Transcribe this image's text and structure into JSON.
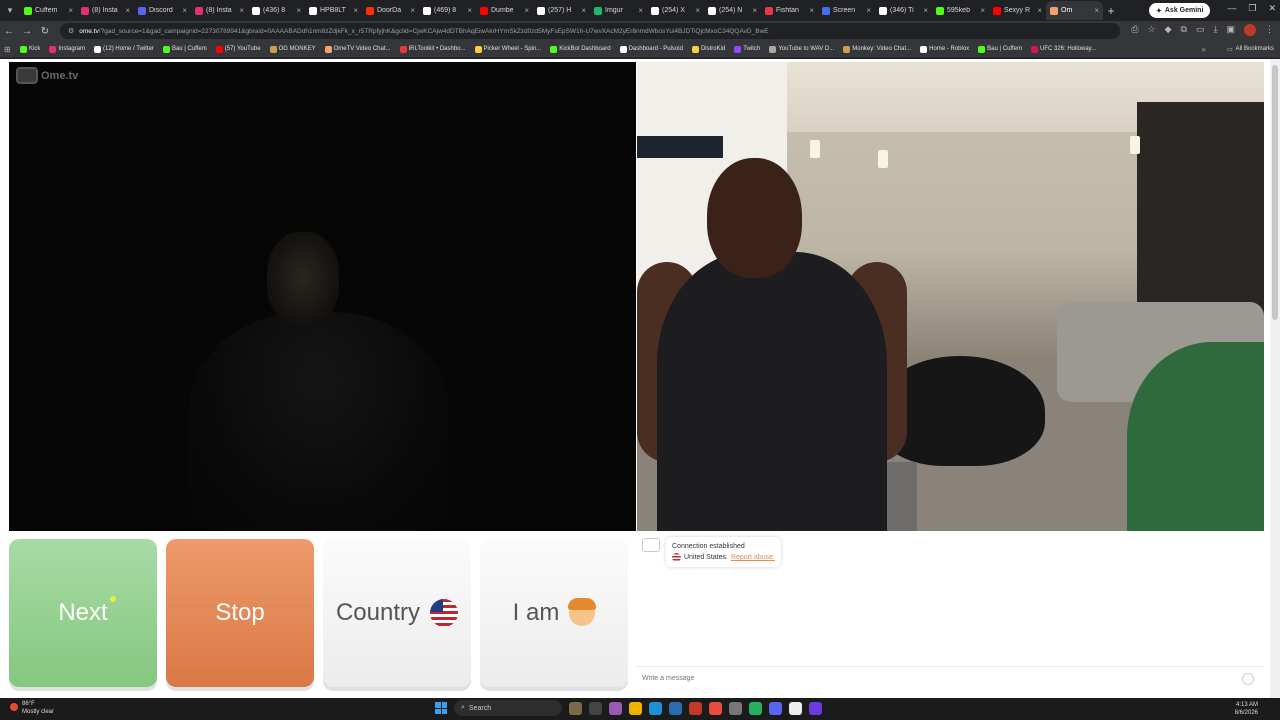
{
  "browser": {
    "tabs": [
      {
        "label": "Cuffem",
        "color": "#53fc18"
      },
      {
        "label": "(8) Insta",
        "color": "#e1306c"
      },
      {
        "label": "Discord",
        "color": "#5865f2"
      },
      {
        "label": "(8) Insta",
        "color": "#e1306c"
      },
      {
        "label": "(436) 8",
        "color": "#ffffff"
      },
      {
        "label": "HPB8LT",
        "color": "#ffffff"
      },
      {
        "label": "DoorDa",
        "color": "#ff3008"
      },
      {
        "label": "(469) 8",
        "color": "#ffffff"
      },
      {
        "label": "Dumbe",
        "color": "#ff0000"
      },
      {
        "label": "(257) H",
        "color": "#ffffff"
      },
      {
        "label": "Imgur",
        "color": "#1bb76e"
      },
      {
        "label": "(254) X",
        "color": "#ffffff"
      },
      {
        "label": "(254) N",
        "color": "#ffffff"
      },
      {
        "label": "Fishtan",
        "color": "#e63946"
      },
      {
        "label": "Screen",
        "color": "#4a6cf7"
      },
      {
        "label": "(346) Ti",
        "color": "#ffffff"
      },
      {
        "label": "595keb",
        "color": "#53fc18"
      },
      {
        "label": "Sexyy R",
        "color": "#ff0000"
      },
      {
        "label": "Om",
        "color": "#f5a36b"
      }
    ],
    "active_tab_index": 18,
    "ask_gemini": "Ask Gemini",
    "url_domain": "ome.tv",
    "url_rest": "/?gad_source=1&gad_campaignid=22730789941&gbraid=0AAAABADdh1nm8zZdjkFk_x_r5TRpfyjhK&gclid=CjwKCAjw4dDTBhAqEiwAkrHYmSkZzd0zd5MyFsEpSW1h-U7wvXAcM2yEr8nmdWbosYui4BJDTiQjcMxoC34QQAvD_BwE",
    "bookmarks": [
      {
        "label": "Kick",
        "color": "#53fc18"
      },
      {
        "label": "Instagram",
        "color": "#e1306c"
      },
      {
        "label": "(12) Home / Twitter",
        "color": "#ffffff"
      },
      {
        "label": "Bau | Cuffem",
        "color": "#53fc18"
      },
      {
        "label": "(57) YouTube",
        "color": "#ff0000"
      },
      {
        "label": "OG MONKEY",
        "color": "#c7a04a"
      },
      {
        "label": "OmeTV Video Chat...",
        "color": "#f5a36b"
      },
      {
        "label": "IRLToolkit • Dashbo...",
        "color": "#e63946"
      },
      {
        "label": "Picker Wheel - Spin...",
        "color": "#f4d03f"
      },
      {
        "label": "KickBot Dashboard",
        "color": "#53fc18"
      },
      {
        "label": "Dashboard - Pulsoid",
        "color": "#ffffff"
      },
      {
        "label": "DistroKid",
        "color": "#f4d03f"
      },
      {
        "label": "Twitch",
        "color": "#9146ff"
      },
      {
        "label": "YouTube to WAV D...",
        "color": "#aaaaaa"
      },
      {
        "label": "Monkey: Video Chat...",
        "color": "#c7a04a"
      },
      {
        "label": "Home - Roblox",
        "color": "#ffffff"
      },
      {
        "label": "Bau | Cuffem",
        "color": "#53fc18"
      },
      {
        "label": "UFC 326: Holloway...",
        "color": "#d4145a"
      }
    ],
    "all_bookmarks": "All Bookmarks"
  },
  "site": {
    "logo_text": "Ome.tv",
    "buttons": {
      "next": "Next",
      "stop": "Stop",
      "country": "Country",
      "iam": "I am"
    },
    "chat": {
      "status": "Connection established",
      "country": "United States.",
      "report": "Report abuse.",
      "placeholder": "Write a message"
    }
  },
  "taskbar": {
    "weather_temp": "86°F",
    "weather_desc": "Mostly clear",
    "search": "Search",
    "time": "4:13 AM",
    "date": "8/6/2026"
  }
}
